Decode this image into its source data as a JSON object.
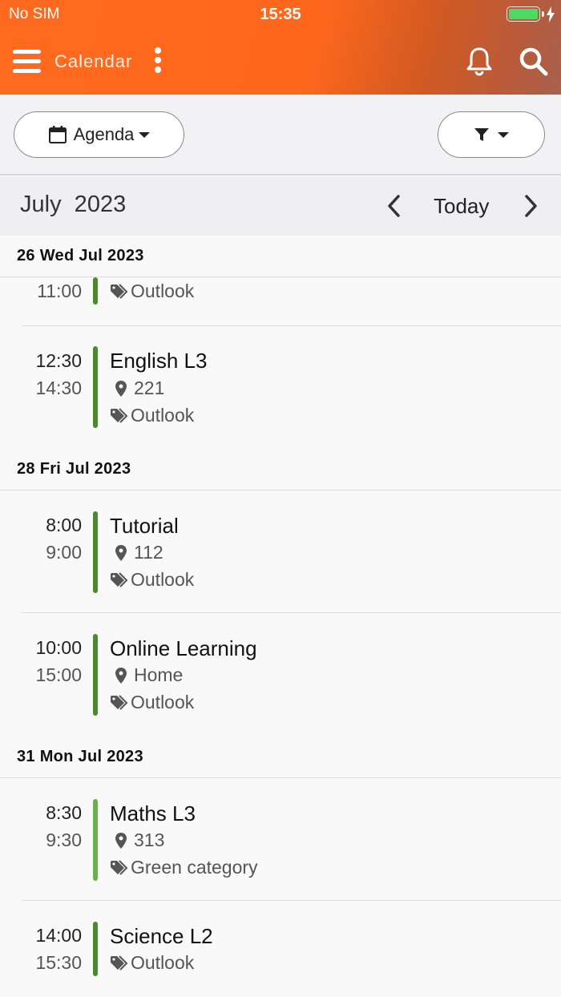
{
  "status_bar": {
    "carrier": "No SIM",
    "time": "15:35",
    "battery_color": "#4cd964"
  },
  "header": {
    "title": "Calendar",
    "accent_color": "#ff6a1f"
  },
  "toolbar": {
    "view_label": "Agenda",
    "view_icon": "calendar-icon",
    "filter_icon": "filter-icon"
  },
  "month_nav": {
    "title": "July  2023",
    "today_label": "Today"
  },
  "days": [
    {
      "date": "26 Wed Jul 2023",
      "events": [
        {
          "start": "",
          "end": "11:00",
          "title": "",
          "location": "",
          "category": "Outlook"
        },
        {
          "start": "12:30",
          "end": "14:30",
          "title": "English L3",
          "location": "221",
          "category": "Outlook"
        }
      ]
    },
    {
      "date": "28 Fri Jul 2023",
      "events": [
        {
          "start": "8:00",
          "end": "9:00",
          "title": "Tutorial",
          "location": "112",
          "category": "Outlook"
        },
        {
          "start": "10:00",
          "end": "15:00",
          "title": "Online Learning",
          "location": "Home",
          "category": "Outlook"
        }
      ]
    },
    {
      "date": "31 Mon Jul 2023",
      "events": [
        {
          "start": "8:30",
          "end": "9:30",
          "title": "Maths L3",
          "location": "313",
          "category": "Green category"
        },
        {
          "start": "14:00",
          "end": "15:30",
          "title": "Science L2",
          "location": "",
          "category": "Outlook"
        }
      ]
    }
  ],
  "colors": {
    "outlook_bar": "#4a8a2e",
    "green_category_bar": "#6ab04c"
  }
}
